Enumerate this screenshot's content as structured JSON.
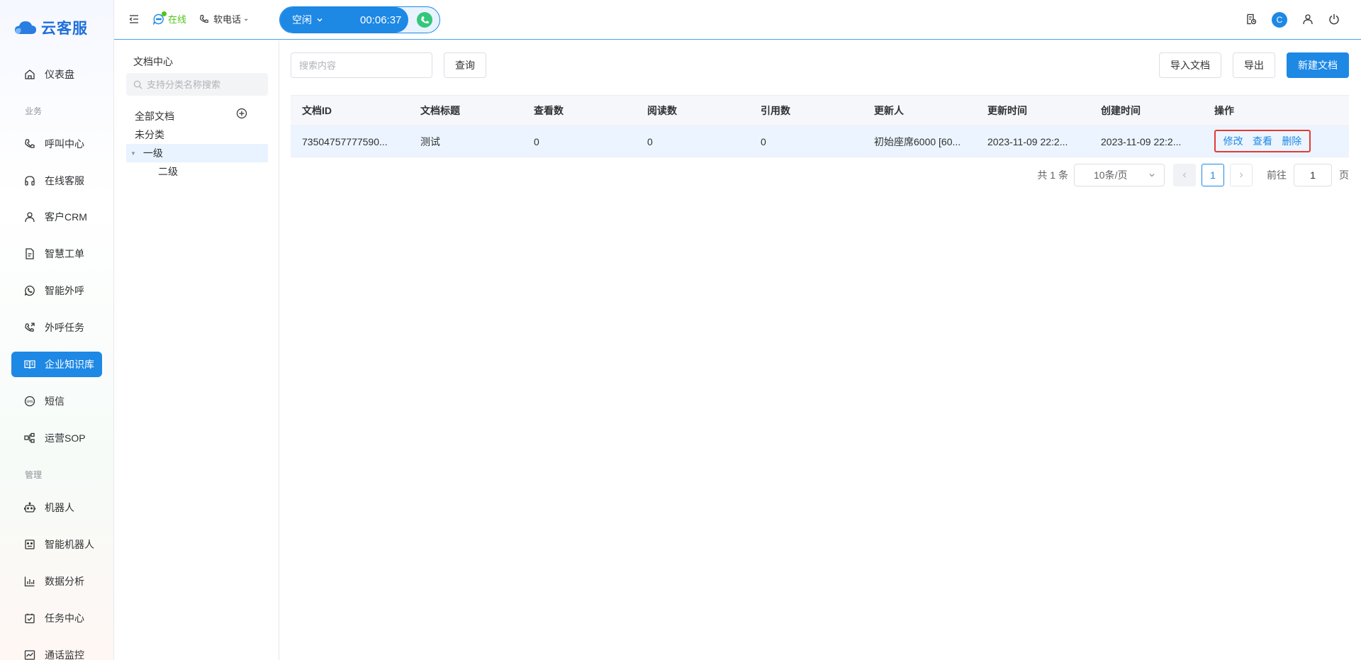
{
  "app": {
    "name": "云客服"
  },
  "sidebar": {
    "items": [
      {
        "label": "仪表盘",
        "icon": "home-icon"
      },
      {
        "label": "呼叫中心",
        "icon": "phone-icon"
      },
      {
        "label": "在线客服",
        "icon": "headset-icon"
      },
      {
        "label": "客户CRM",
        "icon": "user-icon"
      },
      {
        "label": "智慧工单",
        "icon": "document-icon"
      },
      {
        "label": "智能外呼",
        "icon": "whatsapp-phone-icon"
      },
      {
        "label": "外呼任务",
        "icon": "phone-outgoing-icon"
      },
      {
        "label": "企业知识库",
        "icon": "book-icon",
        "active": true
      },
      {
        "label": "短信",
        "icon": "sms-icon"
      },
      {
        "label": "运营SOP",
        "icon": "flow-icon"
      },
      {
        "label": "机器人",
        "icon": "robot-icon"
      },
      {
        "label": "智能机器人",
        "icon": "smart-robot-icon"
      },
      {
        "label": "数据分析",
        "icon": "bar-chart-icon"
      },
      {
        "label": "任务中心",
        "icon": "task-icon"
      },
      {
        "label": "通话监控",
        "icon": "monitor-icon"
      }
    ],
    "sections": {
      "business": "业务",
      "management": "管理"
    }
  },
  "header": {
    "status": "在线",
    "softphone": "软电话",
    "call_state": "空闲",
    "timer": "00:06:37",
    "avatar_letter": "C"
  },
  "tree": {
    "title": "文档中心",
    "search_placeholder": "支持分类名称搜索",
    "nodes": [
      "全部文档",
      "未分类",
      "一级",
      "二级"
    ]
  },
  "toolbar": {
    "search_placeholder": "搜索内容",
    "query_label": "查询",
    "import_label": "导入文档",
    "export_label": "导出",
    "new_label": "新建文档"
  },
  "table": {
    "columns": [
      "文档ID",
      "文档标题",
      "查看数",
      "阅读数",
      "引用数",
      "更新人",
      "更新时间",
      "创建时间",
      "操作"
    ],
    "rows": [
      {
        "id": "73504757777590...",
        "title": "测试",
        "views": "0",
        "reads": "0",
        "refs": "0",
        "updater": "初始座席6000 [60...",
        "updated": "2023-11-09 22:2...",
        "created": "2023-11-09 22:2...",
        "actions": [
          "修改",
          "查看",
          "删除"
        ]
      }
    ]
  },
  "pagination": {
    "total_text": "共 1 条",
    "page_size": "10条/页",
    "current_page": "1",
    "goto_label": "前往",
    "goto_value": "1",
    "page_unit": "页"
  },
  "colors": {
    "accent": "#1e88e5",
    "online": "#52c41a",
    "highlight_border": "#e53935"
  }
}
